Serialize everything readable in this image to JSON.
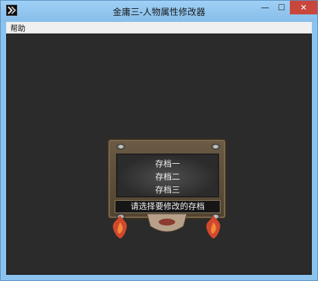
{
  "window": {
    "title": "金庸三-人物属性修改器",
    "controls": {
      "minimize": "—",
      "maximize": "☐",
      "close": "✕"
    }
  },
  "menu": {
    "items": [
      "帮助"
    ]
  },
  "save_slots": {
    "slot_1": "存档一",
    "slot_2": "存档二",
    "slot_3": "存档三",
    "prompt": "请选择要修改的存档"
  },
  "colors": {
    "title_bar": "#8cc3ee",
    "close_button": "#c9463d",
    "client_bg": "#2b2b2b",
    "board_wood": "#6b5a44",
    "flame": "#d2482c"
  }
}
